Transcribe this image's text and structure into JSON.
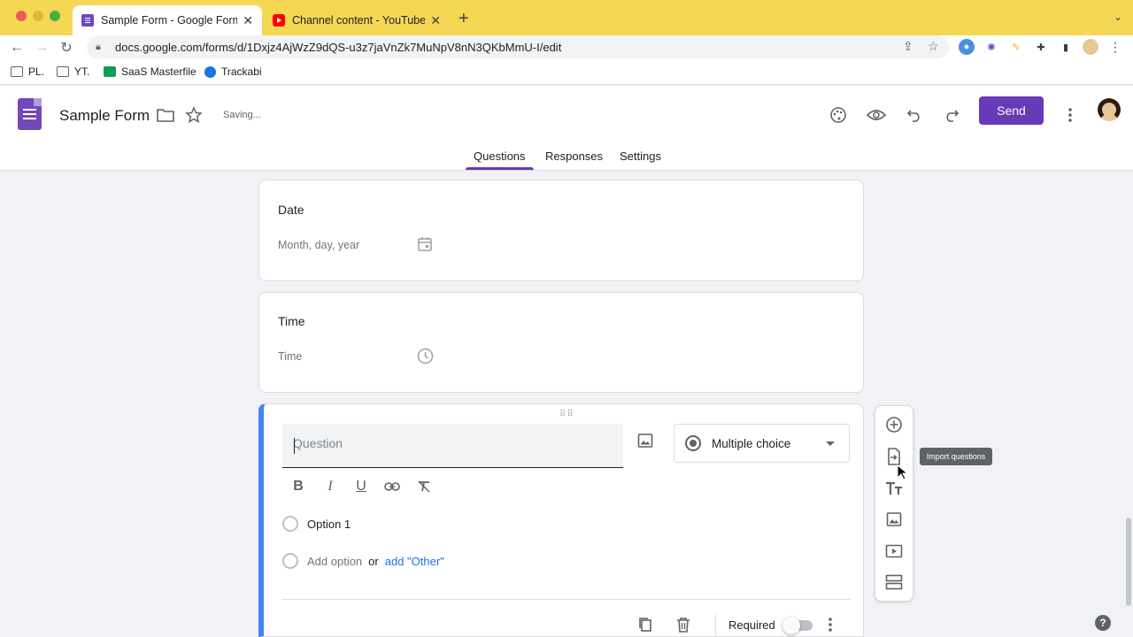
{
  "browser": {
    "tabs": [
      {
        "title": "Sample Form - Google Forms",
        "active": true
      },
      {
        "title": "Channel content - YouTube Stu",
        "active": false
      }
    ],
    "url": "docs.google.com/forms/d/1Dxjz4AjWzZ9dQS-u3z7jaVnZk7MuNpV8nN3QKbMmU-I/edit",
    "bookmarks": [
      "PL.",
      "YT.",
      "SaaS Masterfile",
      "Trackabi"
    ]
  },
  "header": {
    "form_title": "Sample Form",
    "status": "Saving...",
    "send_label": "Send",
    "tabs": [
      "Questions",
      "Responses",
      "Settings"
    ],
    "active_tab": "Questions"
  },
  "cards": [
    {
      "title": "Date",
      "placeholder": "Month, day, year",
      "icon": "calendar-icon"
    },
    {
      "title": "Time",
      "placeholder": "Time",
      "icon": "clock-icon"
    }
  ],
  "active_question": {
    "placeholder": "Question",
    "type": "Multiple choice",
    "options": [
      "Option 1"
    ],
    "add_option": "Add option",
    "or": "or",
    "add_other": "add \"Other\"",
    "required_label": "Required"
  },
  "tooltip": "Import questions",
  "colors": {
    "accent": "#673ab7",
    "focus_border": "#4285f4",
    "tab_strip": "#f4d853"
  }
}
